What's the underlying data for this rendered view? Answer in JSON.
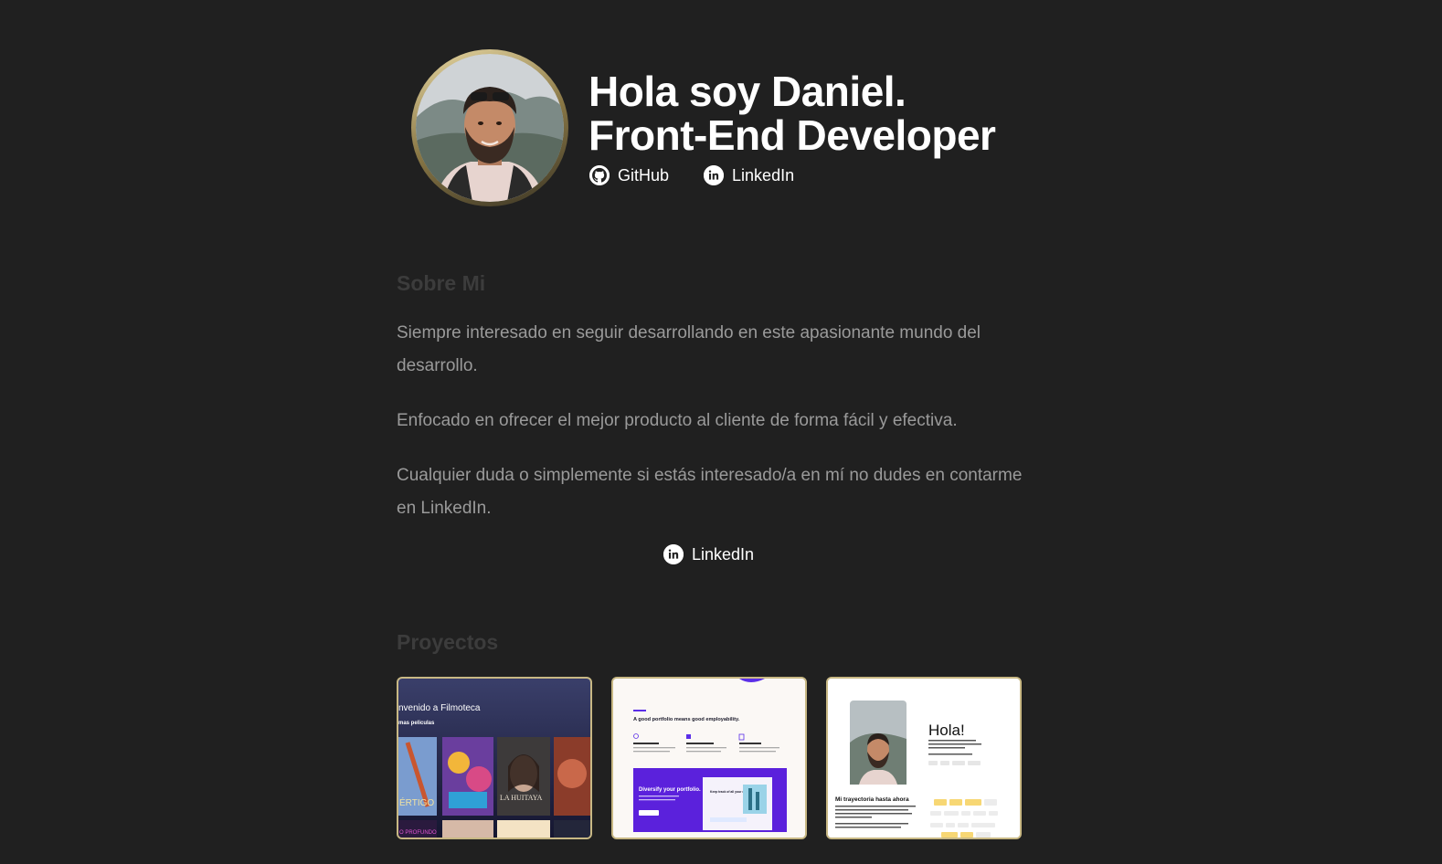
{
  "header": {
    "title_line1": "Hola soy Daniel.",
    "title_line2": "Front-End Developer",
    "links": [
      {
        "label": "GitHub",
        "icon": "github-icon"
      },
      {
        "label": "LinkedIn",
        "icon": "linkedin-icon"
      }
    ]
  },
  "about": {
    "title": "Sobre Mi",
    "paragraphs": [
      "Siempre interesado en seguir desarrollando en este apasionante mundo del desarrollo.",
      "Enfocado en ofrecer el mejor producto al cliente de forma fácil y efectiva.",
      "Cualquier duda o simplemente si estás interesado/a en mí no dudes en contarme en LinkedIn."
    ],
    "link_label": "LinkedIn"
  },
  "projects": {
    "title": "Proyectos",
    "cards": [
      {
        "heading": "nvenido a Filmoteca",
        "sub": "mas peliculas",
        "posters": [
          "ÉRTIGO",
          "LA HUITAYA",
          "O PROFUNDO"
        ]
      },
      {
        "heading": "A good portfolio means good employability.",
        "banner": "Diversify your portfolio.",
        "banner_sub": "Keep track of all your creative works."
      },
      {
        "heading": "Hola!",
        "sub": "Mi trayectoria hasta ahora"
      }
    ]
  },
  "colors": {
    "background": "#202020",
    "muted_heading": "#3c3c3c",
    "body_text": "#9a9a9a",
    "accent_border": "#c8b884"
  }
}
